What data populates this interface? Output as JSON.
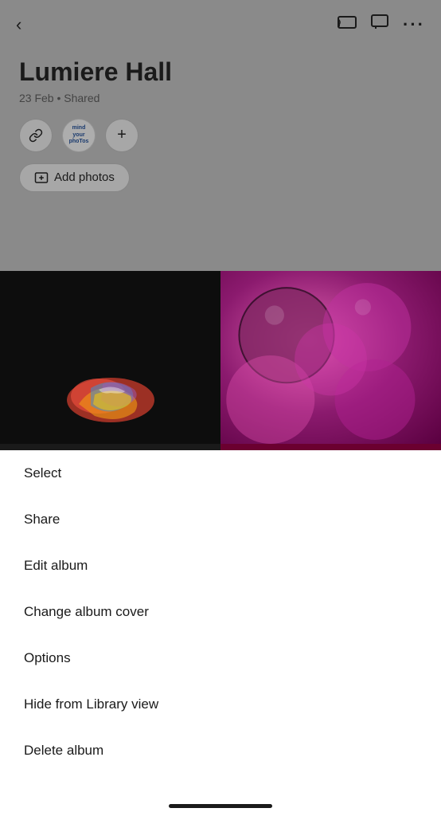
{
  "header": {
    "title": "Lumiere Hall",
    "meta": "23 Feb • Shared",
    "back_icon": "‹",
    "cast_icon": "⬛",
    "speech_icon": "💬",
    "more_icon": "···"
  },
  "avatar": {
    "text": "mind\nyour\nPhoTos"
  },
  "buttons": {
    "add_photos": "Add photos",
    "add_icon": "+"
  },
  "menu": {
    "items": [
      {
        "label": "Select"
      },
      {
        "label": "Share"
      },
      {
        "label": "Edit album"
      },
      {
        "label": "Change album cover"
      },
      {
        "label": "Options"
      },
      {
        "label": "Hide from Library view"
      },
      {
        "label": "Delete album"
      }
    ]
  }
}
